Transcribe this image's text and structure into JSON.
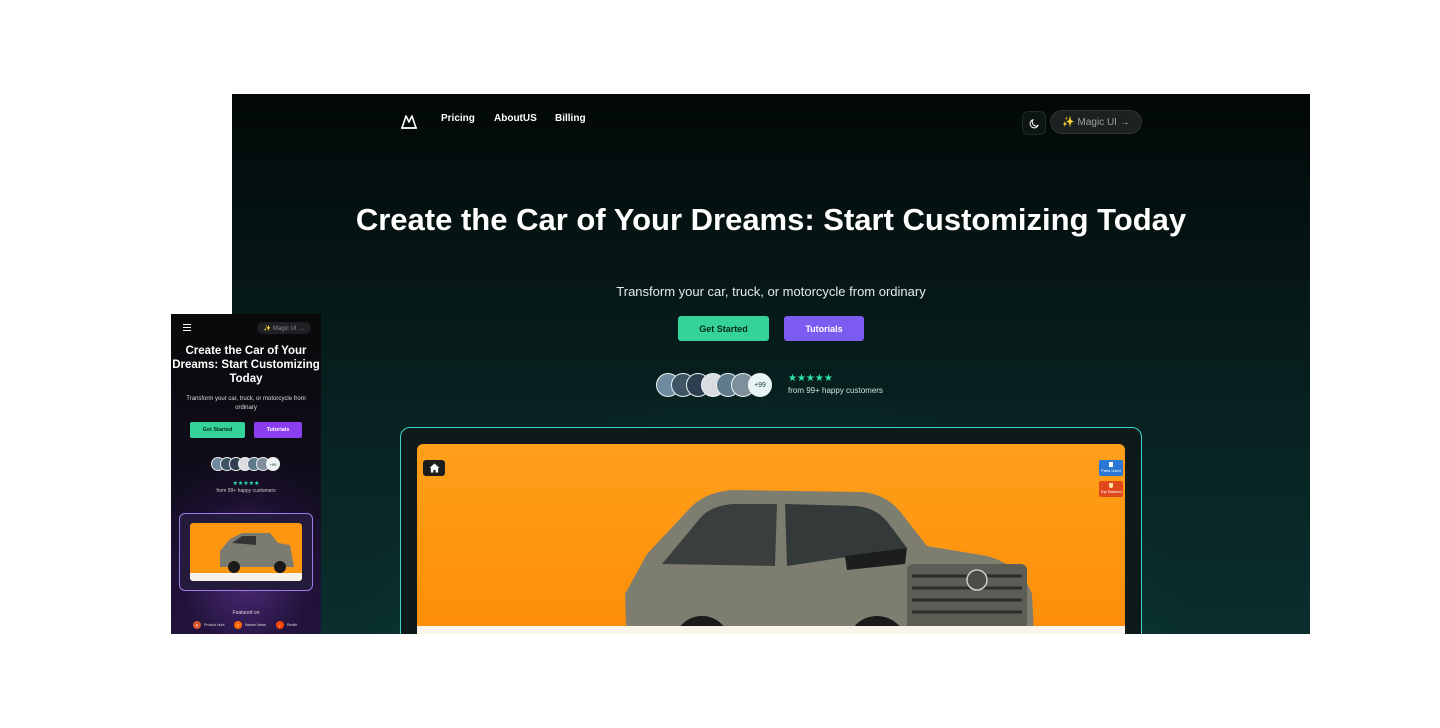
{
  "desktop": {
    "nav": {
      "links": [
        "Pricing",
        "AboutUS",
        "Billing"
      ],
      "magic_button": "✨ Magic UI →"
    },
    "hero": {
      "title": "Create the Car of Your Dreams: Start Customizing Today",
      "subtitle": "Transform your car, truck, or motorcycle from ordinary",
      "primary_button": "Get Started",
      "secondary_button": "Tutorials"
    },
    "social_proof": {
      "more_count": "+99",
      "stars": "★★★★★",
      "caption": "from 99+ happy customers"
    },
    "preview": {
      "badge_parts": "Parts Used",
      "badge_top": "Top Ranked"
    }
  },
  "mobile": {
    "magic_button": "✨ Magic UI →",
    "title": "Create the Car of Your Dreams: Start Customizing Today",
    "subtitle": "Transform your car, truck, or motorcycle from ordinary",
    "primary_button": "Get Started",
    "secondary_button": "Tutorials",
    "more_count": "+99",
    "stars": "★★★★★",
    "caption": "from 99+ happy customers",
    "featured_label": "Featured on",
    "featured": [
      {
        "name": "Product Hunt",
        "letter": "P",
        "color": "#da552f"
      },
      {
        "name": "Hacker News",
        "letter": "Y",
        "color": "#ff6600"
      },
      {
        "name": "Reddit",
        "letter": "r",
        "color": "#ff4500"
      }
    ]
  }
}
